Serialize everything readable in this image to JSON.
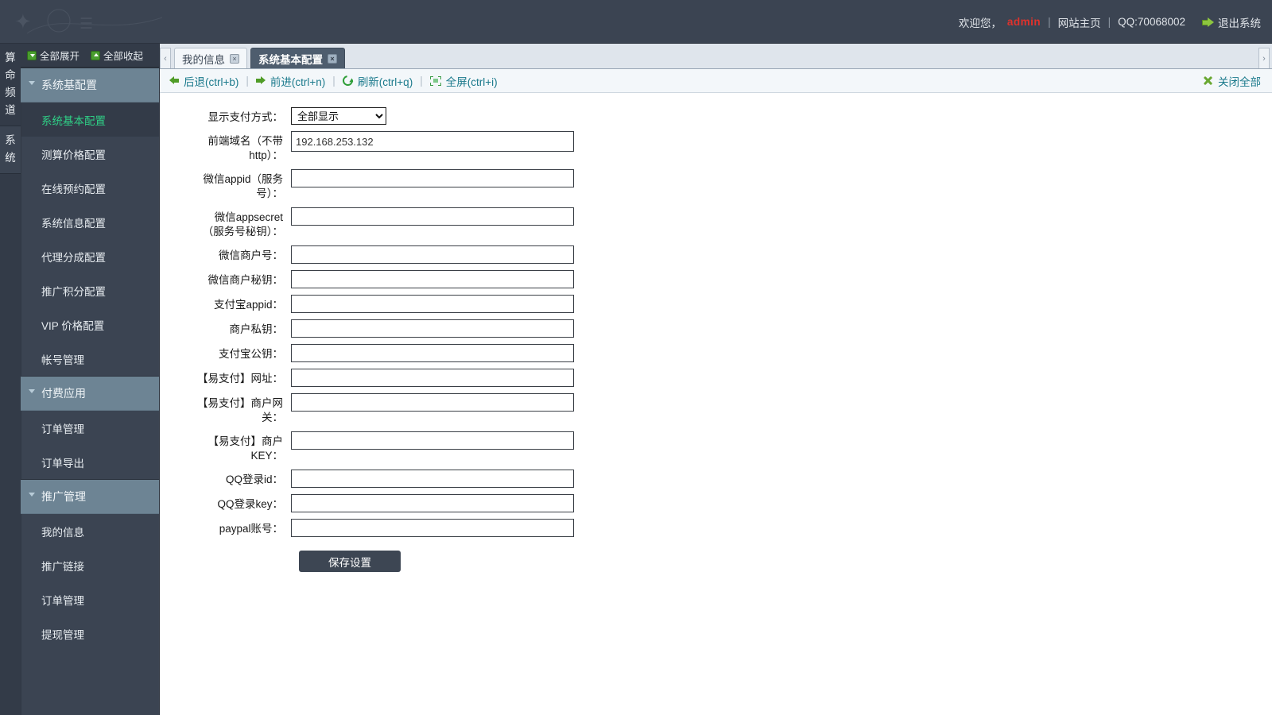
{
  "header": {
    "welcome_text": "欢迎您，",
    "username": "admin",
    "sep": "|",
    "home_link": "网站主页",
    "qq": "QQ:70068002",
    "logout": "退出系统"
  },
  "vertical_tabs": [
    {
      "label": "算命频道",
      "active": false
    },
    {
      "label": "系统",
      "active": true
    }
  ],
  "sidebar": {
    "expand_all": "全部展开",
    "collapse_all": "全部收起",
    "groups": [
      {
        "label": "系统基配置",
        "items": [
          {
            "label": "系统基本配置",
            "active": true
          },
          {
            "label": "测算价格配置",
            "active": false
          },
          {
            "label": "在线预约配置",
            "active": false
          },
          {
            "label": "系统信息配置",
            "active": false
          },
          {
            "label": "代理分成配置",
            "active": false
          },
          {
            "label": "推广积分配置",
            "active": false
          },
          {
            "label": "VIP 价格配置",
            "active": false
          },
          {
            "label": "帐号管理",
            "active": false
          }
        ]
      },
      {
        "label": "付费应用",
        "items": [
          {
            "label": "订单管理",
            "active": false
          },
          {
            "label": "订单导出",
            "active": false
          }
        ]
      },
      {
        "label": "推广管理",
        "items": [
          {
            "label": "我的信息",
            "active": false
          },
          {
            "label": "推广链接",
            "active": false
          },
          {
            "label": "订单管理",
            "active": false
          },
          {
            "label": "提现管理",
            "active": false
          }
        ]
      }
    ]
  },
  "tabs": {
    "nav_left": "‹",
    "nav_right": "›",
    "close_glyph": "×",
    "items": [
      {
        "label": "我的信息",
        "active": false
      },
      {
        "label": "系统基本配置",
        "active": true
      }
    ]
  },
  "toolbar": {
    "back": "后退(ctrl+b)",
    "forward": "前进(ctrl+n)",
    "refresh": "刷新(ctrl+q)",
    "fullscreen": "全屏(ctrl+i)",
    "separator": "|",
    "close_all": "关闭全部"
  },
  "form": {
    "fields": [
      {
        "label": "显示支付方式：",
        "type": "select",
        "value": "全部显示",
        "options": [
          "全部显示"
        ]
      },
      {
        "label": "前端域名（不带http）：",
        "type": "text",
        "value": "192.168.253.132",
        "placeholder": "",
        "tall": true
      },
      {
        "label": "微信appid（服务号）：",
        "type": "text",
        "value": "",
        "placeholder": "",
        "tall": false
      },
      {
        "label": "微信appsecret（服务号秘钥）：",
        "type": "text",
        "value": "",
        "placeholder": "",
        "tall": false
      },
      {
        "label": "微信商户号：",
        "type": "text",
        "value": "",
        "placeholder": "",
        "tall": false
      },
      {
        "label": "微信商户秘钥：",
        "type": "text",
        "value": "",
        "placeholder": "",
        "tall": false
      },
      {
        "label": "支付宝appid：",
        "type": "text",
        "value": "",
        "placeholder": "",
        "tall": false
      },
      {
        "label": "商户私钥：",
        "type": "text",
        "value": "",
        "placeholder": "",
        "tall": false
      },
      {
        "label": "支付宝公钥：",
        "type": "text",
        "value": "",
        "placeholder": "",
        "tall": false
      },
      {
        "label": "【易支付】网址：",
        "type": "text",
        "value": "",
        "placeholder": "",
        "tall": false
      },
      {
        "label": "【易支付】商户网关：",
        "type": "text",
        "value": "",
        "placeholder": "",
        "tall": false
      },
      {
        "label": "【易支付】商户KEY：",
        "type": "text",
        "value": "",
        "placeholder": "",
        "tall": false
      },
      {
        "label": "QQ登录id：",
        "type": "text",
        "value": "",
        "placeholder": "",
        "tall": false
      },
      {
        "label": "QQ登录key：",
        "type": "text",
        "value": "",
        "placeholder": "",
        "tall": false
      },
      {
        "label": "paypal账号：",
        "type": "text",
        "value": "",
        "placeholder": "",
        "tall": false
      }
    ],
    "save_button": "保存设置"
  },
  "colors": {
    "header_bg": "#3b4452",
    "sidebar_bg": "#3b4452",
    "sidebar_group": "#6d8494",
    "active_item_text": "#2fcf86",
    "username": "#e0322c",
    "toolbar_link": "#1b7a8c",
    "icon_green": "#4f9c27",
    "active_tab_bg": "#4e5d6e",
    "button_bg": "#3d4653"
  }
}
